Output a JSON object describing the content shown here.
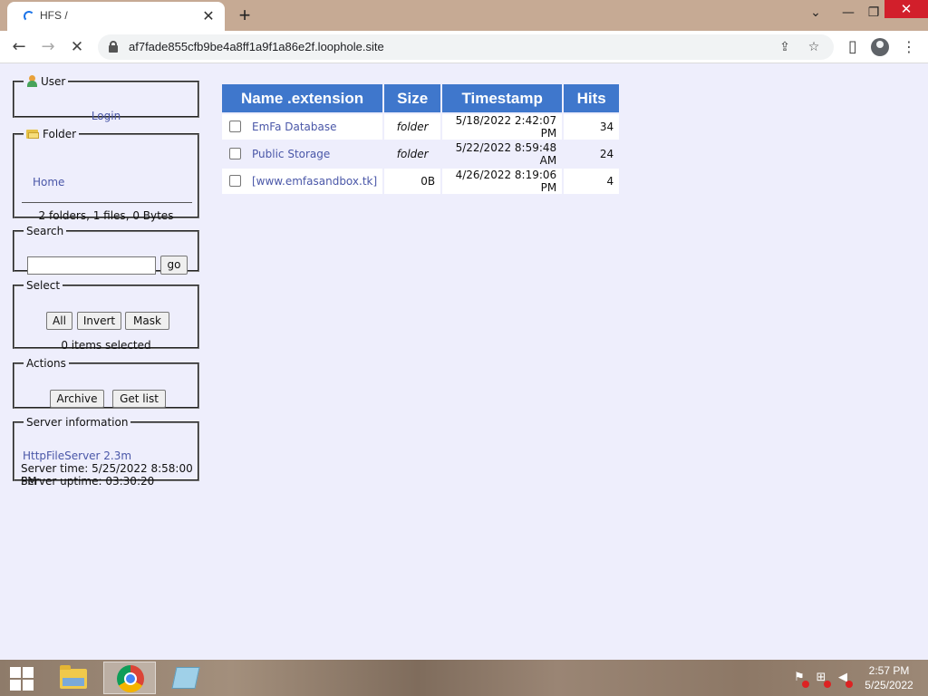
{
  "browser": {
    "tab_title": "HFS /",
    "tab_close": "✕",
    "new_tab": "+",
    "url": "af7fade855cfb9be4a8ff1a9f1a86e2f.loophole.site",
    "window_controls": {
      "chevron": "⌄",
      "minimize": "—",
      "restore": "❐",
      "close": "✕"
    },
    "toolbar_glyphs": {
      "back": "←",
      "forward": "→",
      "stop": "✕",
      "share": "⇪",
      "star": "☆",
      "side_panel": "▯",
      "menu": "⋮"
    }
  },
  "sidebar": {
    "user": {
      "legend": "User",
      "login_label": "Login"
    },
    "folder": {
      "legend": "Folder",
      "home_label": "Home",
      "stats": "2 folders, 1 files, 0 Bytes"
    },
    "search": {
      "legend": "Search",
      "input_value": "",
      "go_label": "go"
    },
    "select": {
      "legend": "Select",
      "all_label": "All",
      "invert_label": "Invert",
      "mask_label": "Mask",
      "count_text": "0 items selected"
    },
    "actions": {
      "legend": "Actions",
      "archive_label": "Archive",
      "getlist_label": "Get list"
    },
    "server": {
      "legend": "Server information",
      "version_link": "HttpFileServer 2.3m",
      "server_time": "Server time: 5/25/2022 8:58:00 PM",
      "server_uptime": "Server uptime: 03:30:20"
    }
  },
  "file_table": {
    "columns": {
      "name": "Name .extension",
      "size": "Size",
      "timestamp": "Timestamp",
      "hits": "Hits"
    },
    "rows": [
      {
        "name": "EmFa Database",
        "size": "folder",
        "timestamp": "5/18/2022 2:42:07 PM",
        "hits": "34"
      },
      {
        "name": "Public Storage",
        "size": "folder",
        "timestamp": "5/22/2022 8:59:48 AM",
        "hits": "24"
      },
      {
        "name": "[www.emfasandbox.tk]",
        "size": "0B",
        "timestamp": "4/26/2022 8:19:06 PM",
        "hits": "4"
      }
    ]
  },
  "taskbar": {
    "apps": [
      "file-explorer-icon",
      "chrome-icon",
      "notepad-icon"
    ],
    "tray_glyphs": {
      "flag": "⚑",
      "network": "⊞",
      "volume": "◀"
    },
    "clock_time": "2:57 PM",
    "clock_date": "5/25/2022"
  },
  "colors": {
    "page_bg": "#eeeefc",
    "header_bg": "#3f77cc",
    "link": "#4a57a8",
    "titlebar": "#c6aa94",
    "close_red": "#d21f2b"
  }
}
